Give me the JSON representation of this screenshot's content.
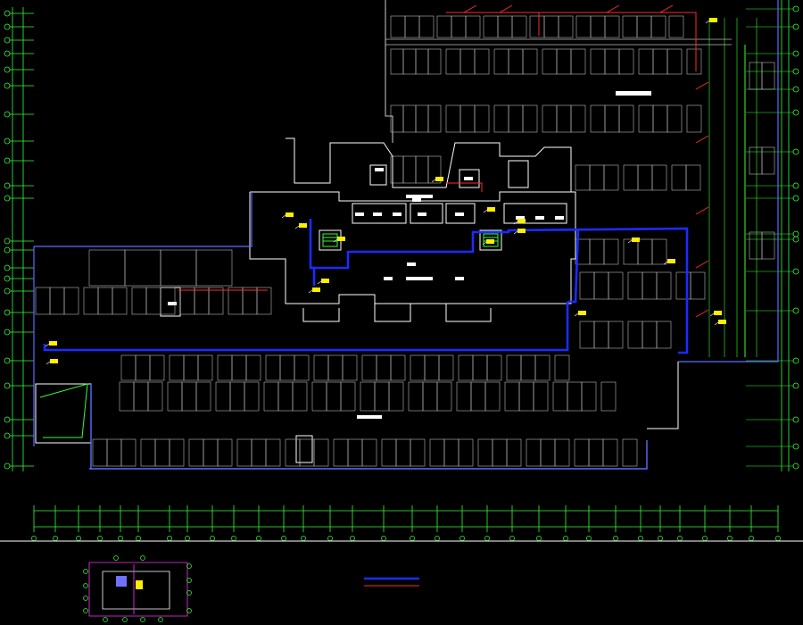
{
  "drawing": {
    "background": "#000000",
    "title_block": {
      "title": "",
      "scale": "",
      "legend": [
        {
          "label": "",
          "color": "#1a2cff"
        },
        {
          "label": "",
          "color": "#ff2a2a"
        }
      ]
    }
  },
  "colors": {
    "walls": "#ffffff",
    "grid_axis": "#33ff33",
    "dimension": "#33ff33",
    "fire_blue": "#1a2cff",
    "fire_red": "#ff2a2a",
    "parking": "#b8b8b8",
    "outline": "#5b6cff",
    "yellow_tag": "#ffee00",
    "magenta": "#ff33ff"
  },
  "icons": [
    "axis-bubble-icon",
    "equipment-tag-icon",
    "stair-icon",
    "north-arrow-icon"
  ]
}
